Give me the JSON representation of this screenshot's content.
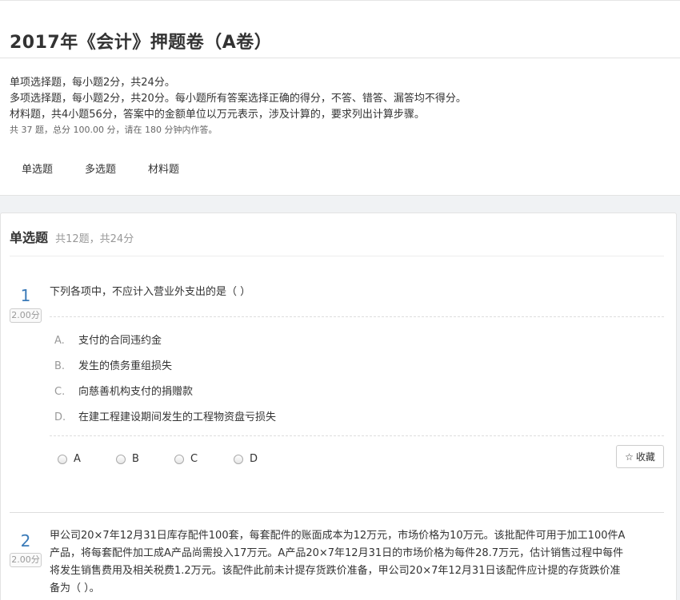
{
  "exam": {
    "title": "2017年《会计》押题卷（A卷）",
    "desc": [
      "单项选择题，每小题2分，共24分。",
      "多项选择题，每小题2分，共20分。每小题所有答案选择正确的得分，不答、错答、漏答均不得分。",
      "材料题，共4小题56分，答案中的金额单位以万元表示，涉及计算的，要求列出计算步骤。"
    ],
    "summary": "共 37 题，总分 100.00 分，请在 180 分钟内作答。"
  },
  "tabs": [
    "单选题",
    "多选题",
    "材料题"
  ],
  "section": {
    "name": "单选题",
    "info": "共12题，共24分"
  },
  "questions": [
    {
      "number": "1",
      "score": "2.00分",
      "stem": "下列各项中，不应计入营业外支出的是（   ）",
      "options": [
        {
          "letter": "A.",
          "text": "支付的合同违约金"
        },
        {
          "letter": "B.",
          "text": "发生的债务重组损失"
        },
        {
          "letter": "C.",
          "text": "向慈善机构支付的捐赠款"
        },
        {
          "letter": "D.",
          "text": "在建工程建设期间发生的工程物资盘亏损失"
        }
      ],
      "answers": [
        "A",
        "B",
        "C",
        "D"
      ]
    },
    {
      "number": "2",
      "score": "2.00分",
      "stem": [
        "甲公司20×7年12月31日库存配件100套，每套配件的账面成本为12万元，市场价格为10万元。该批配件可用于加工100件A",
        "产品，将每套配件加工成A产品尚需投入17万元。A产品20×7年12月31日的市场价格为每件28.7万元，估计销售过程中每件",
        "将发生销售费用及相关税费1.2万元。该配件此前未计提存货跌价准备，甲公司20×7年12月31日该配件应计提的存货跌价准",
        "备为（     ）。"
      ]
    }
  ],
  "favorite": {
    "icon": "star-icon",
    "label": "收藏"
  }
}
